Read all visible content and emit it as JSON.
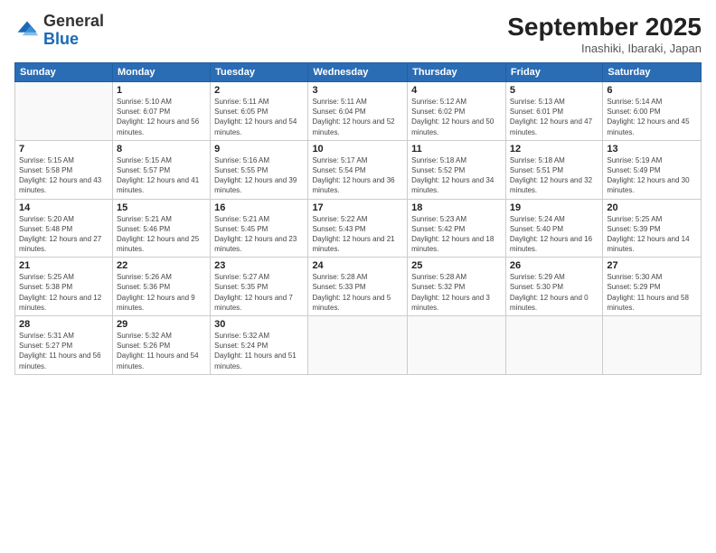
{
  "logo": {
    "general": "General",
    "blue": "Blue"
  },
  "header": {
    "month": "September 2025",
    "location": "Inashiki, Ibaraki, Japan"
  },
  "weekdays": [
    "Sunday",
    "Monday",
    "Tuesday",
    "Wednesday",
    "Thursday",
    "Friday",
    "Saturday"
  ],
  "weeks": [
    [
      {
        "day": "",
        "sunrise": "",
        "sunset": "",
        "daylight": ""
      },
      {
        "day": "1",
        "sunrise": "Sunrise: 5:10 AM",
        "sunset": "Sunset: 6:07 PM",
        "daylight": "Daylight: 12 hours and 56 minutes."
      },
      {
        "day": "2",
        "sunrise": "Sunrise: 5:11 AM",
        "sunset": "Sunset: 6:05 PM",
        "daylight": "Daylight: 12 hours and 54 minutes."
      },
      {
        "day": "3",
        "sunrise": "Sunrise: 5:11 AM",
        "sunset": "Sunset: 6:04 PM",
        "daylight": "Daylight: 12 hours and 52 minutes."
      },
      {
        "day": "4",
        "sunrise": "Sunrise: 5:12 AM",
        "sunset": "Sunset: 6:02 PM",
        "daylight": "Daylight: 12 hours and 50 minutes."
      },
      {
        "day": "5",
        "sunrise": "Sunrise: 5:13 AM",
        "sunset": "Sunset: 6:01 PM",
        "daylight": "Daylight: 12 hours and 47 minutes."
      },
      {
        "day": "6",
        "sunrise": "Sunrise: 5:14 AM",
        "sunset": "Sunset: 6:00 PM",
        "daylight": "Daylight: 12 hours and 45 minutes."
      }
    ],
    [
      {
        "day": "7",
        "sunrise": "Sunrise: 5:15 AM",
        "sunset": "Sunset: 5:58 PM",
        "daylight": "Daylight: 12 hours and 43 minutes."
      },
      {
        "day": "8",
        "sunrise": "Sunrise: 5:15 AM",
        "sunset": "Sunset: 5:57 PM",
        "daylight": "Daylight: 12 hours and 41 minutes."
      },
      {
        "day": "9",
        "sunrise": "Sunrise: 5:16 AM",
        "sunset": "Sunset: 5:55 PM",
        "daylight": "Daylight: 12 hours and 39 minutes."
      },
      {
        "day": "10",
        "sunrise": "Sunrise: 5:17 AM",
        "sunset": "Sunset: 5:54 PM",
        "daylight": "Daylight: 12 hours and 36 minutes."
      },
      {
        "day": "11",
        "sunrise": "Sunrise: 5:18 AM",
        "sunset": "Sunset: 5:52 PM",
        "daylight": "Daylight: 12 hours and 34 minutes."
      },
      {
        "day": "12",
        "sunrise": "Sunrise: 5:18 AM",
        "sunset": "Sunset: 5:51 PM",
        "daylight": "Daylight: 12 hours and 32 minutes."
      },
      {
        "day": "13",
        "sunrise": "Sunrise: 5:19 AM",
        "sunset": "Sunset: 5:49 PM",
        "daylight": "Daylight: 12 hours and 30 minutes."
      }
    ],
    [
      {
        "day": "14",
        "sunrise": "Sunrise: 5:20 AM",
        "sunset": "Sunset: 5:48 PM",
        "daylight": "Daylight: 12 hours and 27 minutes."
      },
      {
        "day": "15",
        "sunrise": "Sunrise: 5:21 AM",
        "sunset": "Sunset: 5:46 PM",
        "daylight": "Daylight: 12 hours and 25 minutes."
      },
      {
        "day": "16",
        "sunrise": "Sunrise: 5:21 AM",
        "sunset": "Sunset: 5:45 PM",
        "daylight": "Daylight: 12 hours and 23 minutes."
      },
      {
        "day": "17",
        "sunrise": "Sunrise: 5:22 AM",
        "sunset": "Sunset: 5:43 PM",
        "daylight": "Daylight: 12 hours and 21 minutes."
      },
      {
        "day": "18",
        "sunrise": "Sunrise: 5:23 AM",
        "sunset": "Sunset: 5:42 PM",
        "daylight": "Daylight: 12 hours and 18 minutes."
      },
      {
        "day": "19",
        "sunrise": "Sunrise: 5:24 AM",
        "sunset": "Sunset: 5:40 PM",
        "daylight": "Daylight: 12 hours and 16 minutes."
      },
      {
        "day": "20",
        "sunrise": "Sunrise: 5:25 AM",
        "sunset": "Sunset: 5:39 PM",
        "daylight": "Daylight: 12 hours and 14 minutes."
      }
    ],
    [
      {
        "day": "21",
        "sunrise": "Sunrise: 5:25 AM",
        "sunset": "Sunset: 5:38 PM",
        "daylight": "Daylight: 12 hours and 12 minutes."
      },
      {
        "day": "22",
        "sunrise": "Sunrise: 5:26 AM",
        "sunset": "Sunset: 5:36 PM",
        "daylight": "Daylight: 12 hours and 9 minutes."
      },
      {
        "day": "23",
        "sunrise": "Sunrise: 5:27 AM",
        "sunset": "Sunset: 5:35 PM",
        "daylight": "Daylight: 12 hours and 7 minutes."
      },
      {
        "day": "24",
        "sunrise": "Sunrise: 5:28 AM",
        "sunset": "Sunset: 5:33 PM",
        "daylight": "Daylight: 12 hours and 5 minutes."
      },
      {
        "day": "25",
        "sunrise": "Sunrise: 5:28 AM",
        "sunset": "Sunset: 5:32 PM",
        "daylight": "Daylight: 12 hours and 3 minutes."
      },
      {
        "day": "26",
        "sunrise": "Sunrise: 5:29 AM",
        "sunset": "Sunset: 5:30 PM",
        "daylight": "Daylight: 12 hours and 0 minutes."
      },
      {
        "day": "27",
        "sunrise": "Sunrise: 5:30 AM",
        "sunset": "Sunset: 5:29 PM",
        "daylight": "Daylight: 11 hours and 58 minutes."
      }
    ],
    [
      {
        "day": "28",
        "sunrise": "Sunrise: 5:31 AM",
        "sunset": "Sunset: 5:27 PM",
        "daylight": "Daylight: 11 hours and 56 minutes."
      },
      {
        "day": "29",
        "sunrise": "Sunrise: 5:32 AM",
        "sunset": "Sunset: 5:26 PM",
        "daylight": "Daylight: 11 hours and 54 minutes."
      },
      {
        "day": "30",
        "sunrise": "Sunrise: 5:32 AM",
        "sunset": "Sunset: 5:24 PM",
        "daylight": "Daylight: 11 hours and 51 minutes."
      },
      {
        "day": "",
        "sunrise": "",
        "sunset": "",
        "daylight": ""
      },
      {
        "day": "",
        "sunrise": "",
        "sunset": "",
        "daylight": ""
      },
      {
        "day": "",
        "sunrise": "",
        "sunset": "",
        "daylight": ""
      },
      {
        "day": "",
        "sunrise": "",
        "sunset": "",
        "daylight": ""
      }
    ]
  ]
}
